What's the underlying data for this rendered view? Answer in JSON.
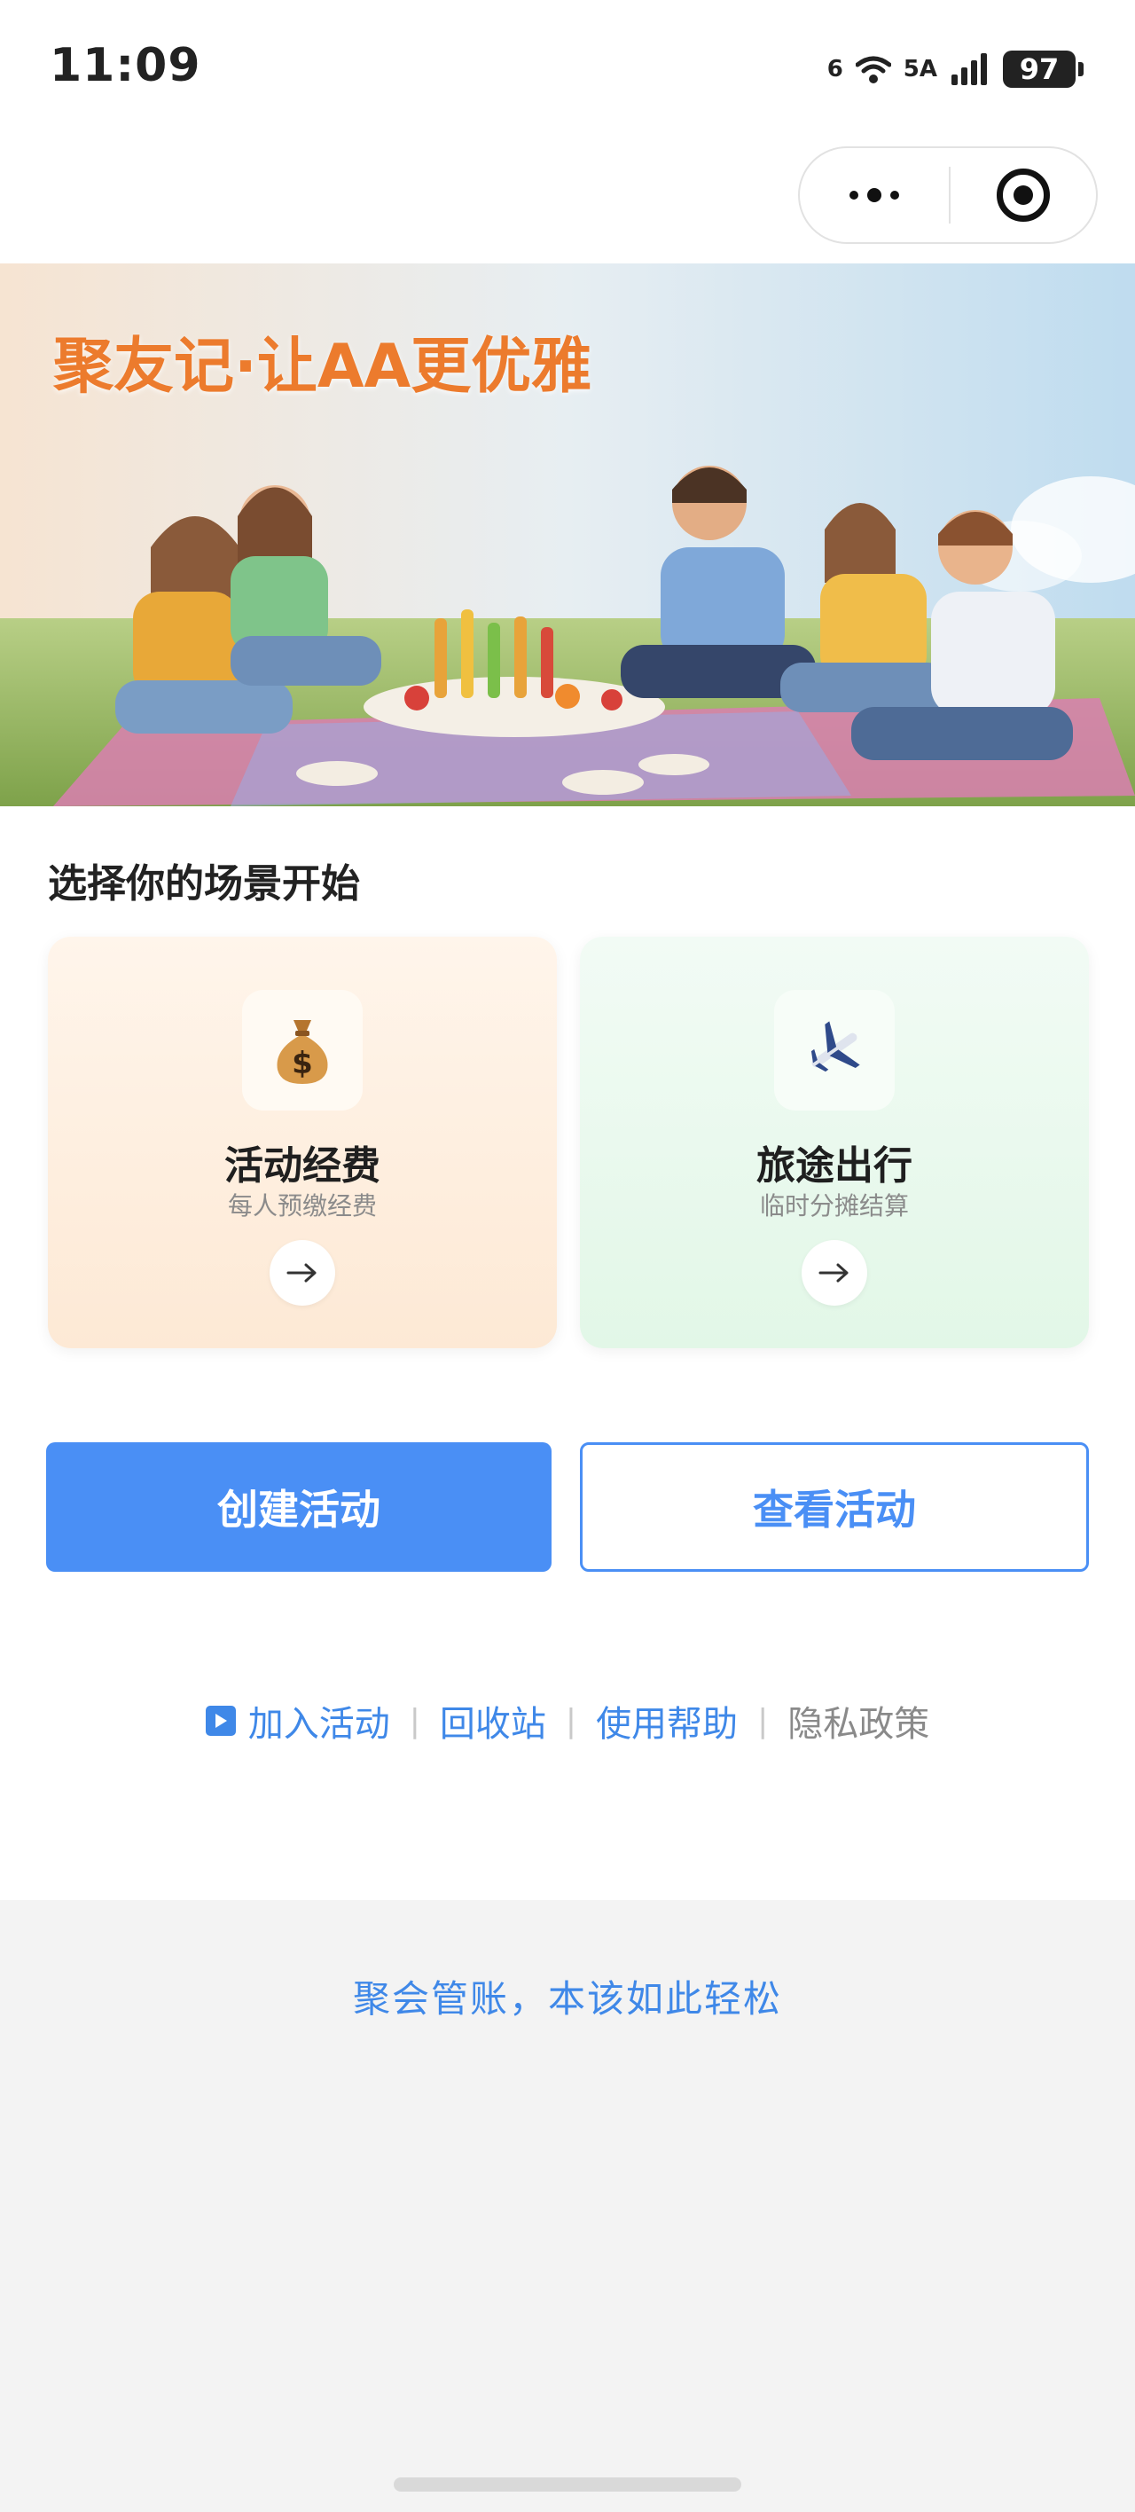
{
  "status_bar": {
    "time": "11:09",
    "net_label_1": "6",
    "net_label_2": "5A",
    "battery": "97"
  },
  "banner": {
    "title": "聚友记·让AA更优雅"
  },
  "section": {
    "title": "选择你的场景开始"
  },
  "scenes": [
    {
      "icon": "money-bag-icon",
      "name": "活动经费",
      "desc": "每人预缴经费"
    },
    {
      "icon": "airplane-icon",
      "name": "旅途出行",
      "desc": "临时分摊结算"
    }
  ],
  "actions": {
    "create": "创建活动",
    "view": "查看活动"
  },
  "links": {
    "join": "加入活动",
    "recycle": "回收站",
    "help": "使用帮助",
    "privacy": "隐私政策"
  },
  "footer": {
    "slogan": "聚会管账，本该如此轻松"
  },
  "colors": {
    "accent": "#4a8ff5",
    "link": "#3f88e8",
    "banner_title": "#ec7b2d"
  }
}
